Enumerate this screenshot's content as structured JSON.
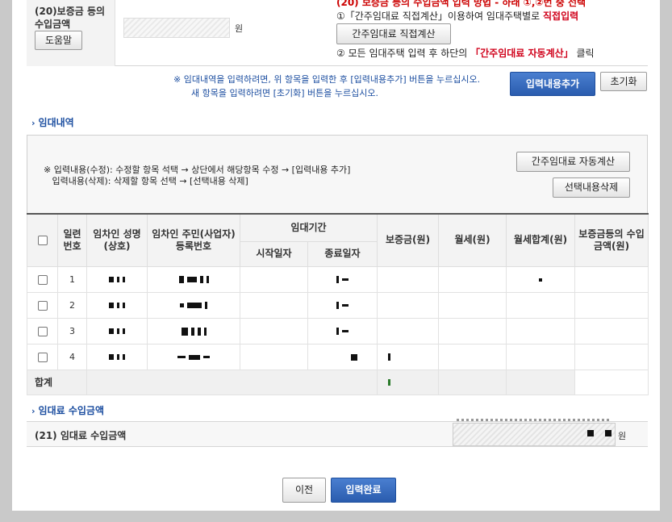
{
  "deposit": {
    "label": "(20)보증금 등의 수입금액",
    "help_button": "도움말",
    "unit": "원",
    "method_header": "(20) 보증금 등의 수입금액 입력 방법 - 하래 ①,②번 중 선택",
    "method1_pre": "①「간주임대료 직접계산」이용하여 임대주택별로",
    "method1_red": "직접입력",
    "direct_calc_button": "간주임대료 직접계산",
    "method2_pre": "② 모든 임대주택 입력 후 하단의",
    "method2_red": "「간주임대료 자동계산」",
    "method2_post": "클릭"
  },
  "notice": {
    "line1": "※ 임대내역을 입력하려면, 위 항목을 입력한 후 [입력내용추가] 버튼을 누르십시오.",
    "line2": "새 항목을 입력하려면 [초기화] 버튼을 누르십시오.",
    "add_button": "입력내용추가",
    "reset_button": "초기화"
  },
  "rental": {
    "section_title": "임대내역",
    "info_line1": "※ 입력내용(수정): 수정할 항목 석택 → 상단에서 해당항목 수정 → [입력내용 추가]",
    "info_line2": "   입력내용(삭제): 삭제할 항목 선택 → [선택내용 삭제]",
    "auto_calc_button": "간주임대료 자동계산",
    "delete_selected_button": "선택내용삭제",
    "headers": {
      "serial": "일련 번호",
      "name": "임차인 성명(상호)",
      "id": "임차인 주민(사업자) 등록번호",
      "period": "임대기간",
      "start": "시작일자",
      "end": "종료일자",
      "deposit": "보증금(원)",
      "monthly": "월세(원)",
      "monthly_total": "월세합계(원)",
      "deposit_income": "보증금등의 수입금액(원)"
    },
    "rows": [
      {
        "no": "1"
      },
      {
        "no": "2"
      },
      {
        "no": "3"
      },
      {
        "no": "4"
      }
    ],
    "total_label": "합계"
  },
  "income": {
    "section_title": "임대료 수입금액",
    "label": "(21) 임대료 수입금액",
    "unit": "원"
  },
  "footer": {
    "prev_button": "이전",
    "done_button": "입력완료"
  }
}
